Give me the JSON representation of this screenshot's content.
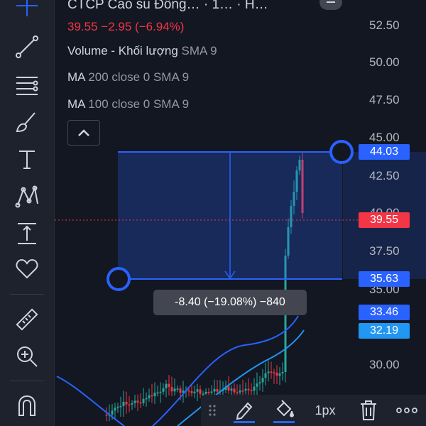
{
  "legend": {
    "title": "CTCP Cao su Đồng…  · 1…  · H…",
    "price_change": "39.55  −2.95 (−6.94%)",
    "volume_name": "Volume - Khối lượng",
    "volume_args": "SMA 9",
    "ma200_name": "MA",
    "ma200_args": "200 close 0 SMA 9",
    "ma100_name": "MA",
    "ma100_args": "100 close 0 SMA 9"
  },
  "price_axis": {
    "labels": [
      "52.50",
      "50.00",
      "47.50",
      "45.00",
      "42.50",
      "40.00",
      "37.50",
      "35.00",
      "30.00"
    ]
  },
  "price_tags": {
    "upper": "44.03",
    "current": "39.55",
    "lower": "35.63",
    "ma_a": "33.46",
    "ma_b": "32.19"
  },
  "measure": {
    "label": "-8.40 (−19.08%) −840"
  },
  "bottom_bar": {
    "width_label": "1px"
  },
  "colors": {
    "background": "#131722",
    "up": "#26a69a",
    "down": "#f23645",
    "accent": "#2962ff",
    "ma_line": "#2962ff"
  },
  "toolbar": {
    "icons": [
      "crosshair-icon",
      "trend-line-icon",
      "fib-icon",
      "brush-icon",
      "text-icon",
      "pattern-icon",
      "measure-icon",
      "favorite-icon",
      "ruler-icon",
      "zoom-in-icon",
      "magnet-icon"
    ]
  }
}
